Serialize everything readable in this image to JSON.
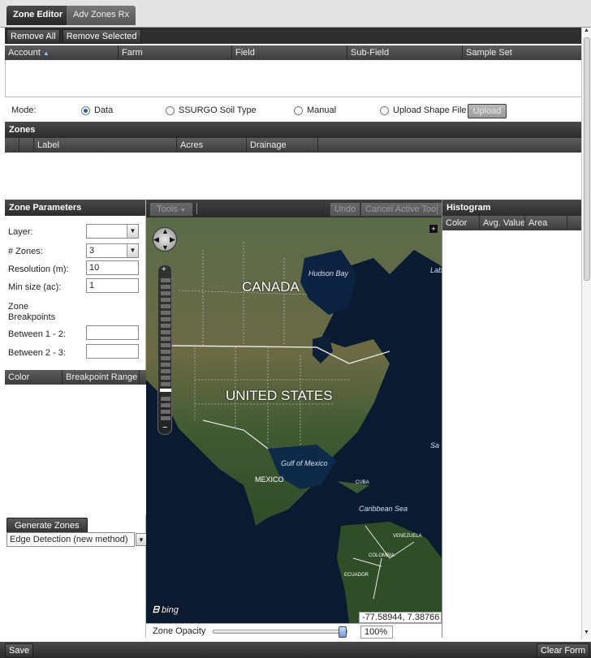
{
  "tabs": [
    {
      "label": "Zone Editor",
      "active": true
    },
    {
      "label": "Adv Zones Rx",
      "active": false
    }
  ],
  "account_grid": {
    "remove_all": "Remove All",
    "remove_selected": "Remove Selected",
    "columns": [
      "Account",
      "Farm",
      "Field",
      "Sub-Field",
      "Sample Set"
    ]
  },
  "mode": {
    "label": "Mode:",
    "options": [
      "Data",
      "SSURGO Soil Type",
      "Manual",
      "Upload Shape File"
    ],
    "selected": "Data",
    "upload_button": "Upload"
  },
  "zones": {
    "title": "Zones",
    "columns": [
      "Label",
      "Acres",
      "Drainage"
    ]
  },
  "zone_parameters": {
    "title": "Zone Parameters",
    "layer_label": "Layer:",
    "layer_value": "",
    "num_zones_label": "# Zones:",
    "num_zones_value": "3",
    "resolution_label": "Resolution (m):",
    "resolution_value": "10",
    "min_size_label": "Min size (ac):",
    "min_size_value": "1",
    "breakpoints_heading_1": "Zone",
    "breakpoints_heading_2": "Breakpoints",
    "between_12_label": "Between 1 - 2:",
    "between_23_label": "Between 2 - 3:",
    "breakpoint_columns": [
      "Color",
      "Breakpoint Range"
    ],
    "generate_button": "Generate Zones",
    "method_value": "Edge Detection (new method)"
  },
  "map_toolbar": {
    "tools": "Tools",
    "undo": "Undo",
    "cancel_tool": "Cancel Active Tool"
  },
  "map": {
    "labels": {
      "canada": "CANADA",
      "united_states": "UNITED STATES",
      "mexico": "MEXICO",
      "hudson_bay": "Hudson Bay",
      "gulf_of_mexico": "Gulf of Mexico",
      "caribbean_sea": "Caribbean Sea",
      "cuba": "CUBA",
      "venezuela": "VENEZUELA",
      "colombia": "COLOMBIA",
      "ecuador": "ECUADOR",
      "lab": "Lab",
      "sar": "Sa"
    },
    "brand": "bing",
    "coordinates": "-77.58944, 7.38766",
    "opacity_label": "Zone Opacity",
    "opacity_value": "100%",
    "opacity_fraction": 1.0
  },
  "histogram": {
    "title": "Histogram",
    "columns": [
      "Color",
      "Avg. Value",
      "Area"
    ]
  },
  "footer": {
    "save": "Save",
    "clear_form": "Clear Form"
  },
  "colors": {
    "dark_bar": "#2e2e2e",
    "radio_selected": "#2a5db0",
    "opacity_handle": "#6e9ccf"
  }
}
